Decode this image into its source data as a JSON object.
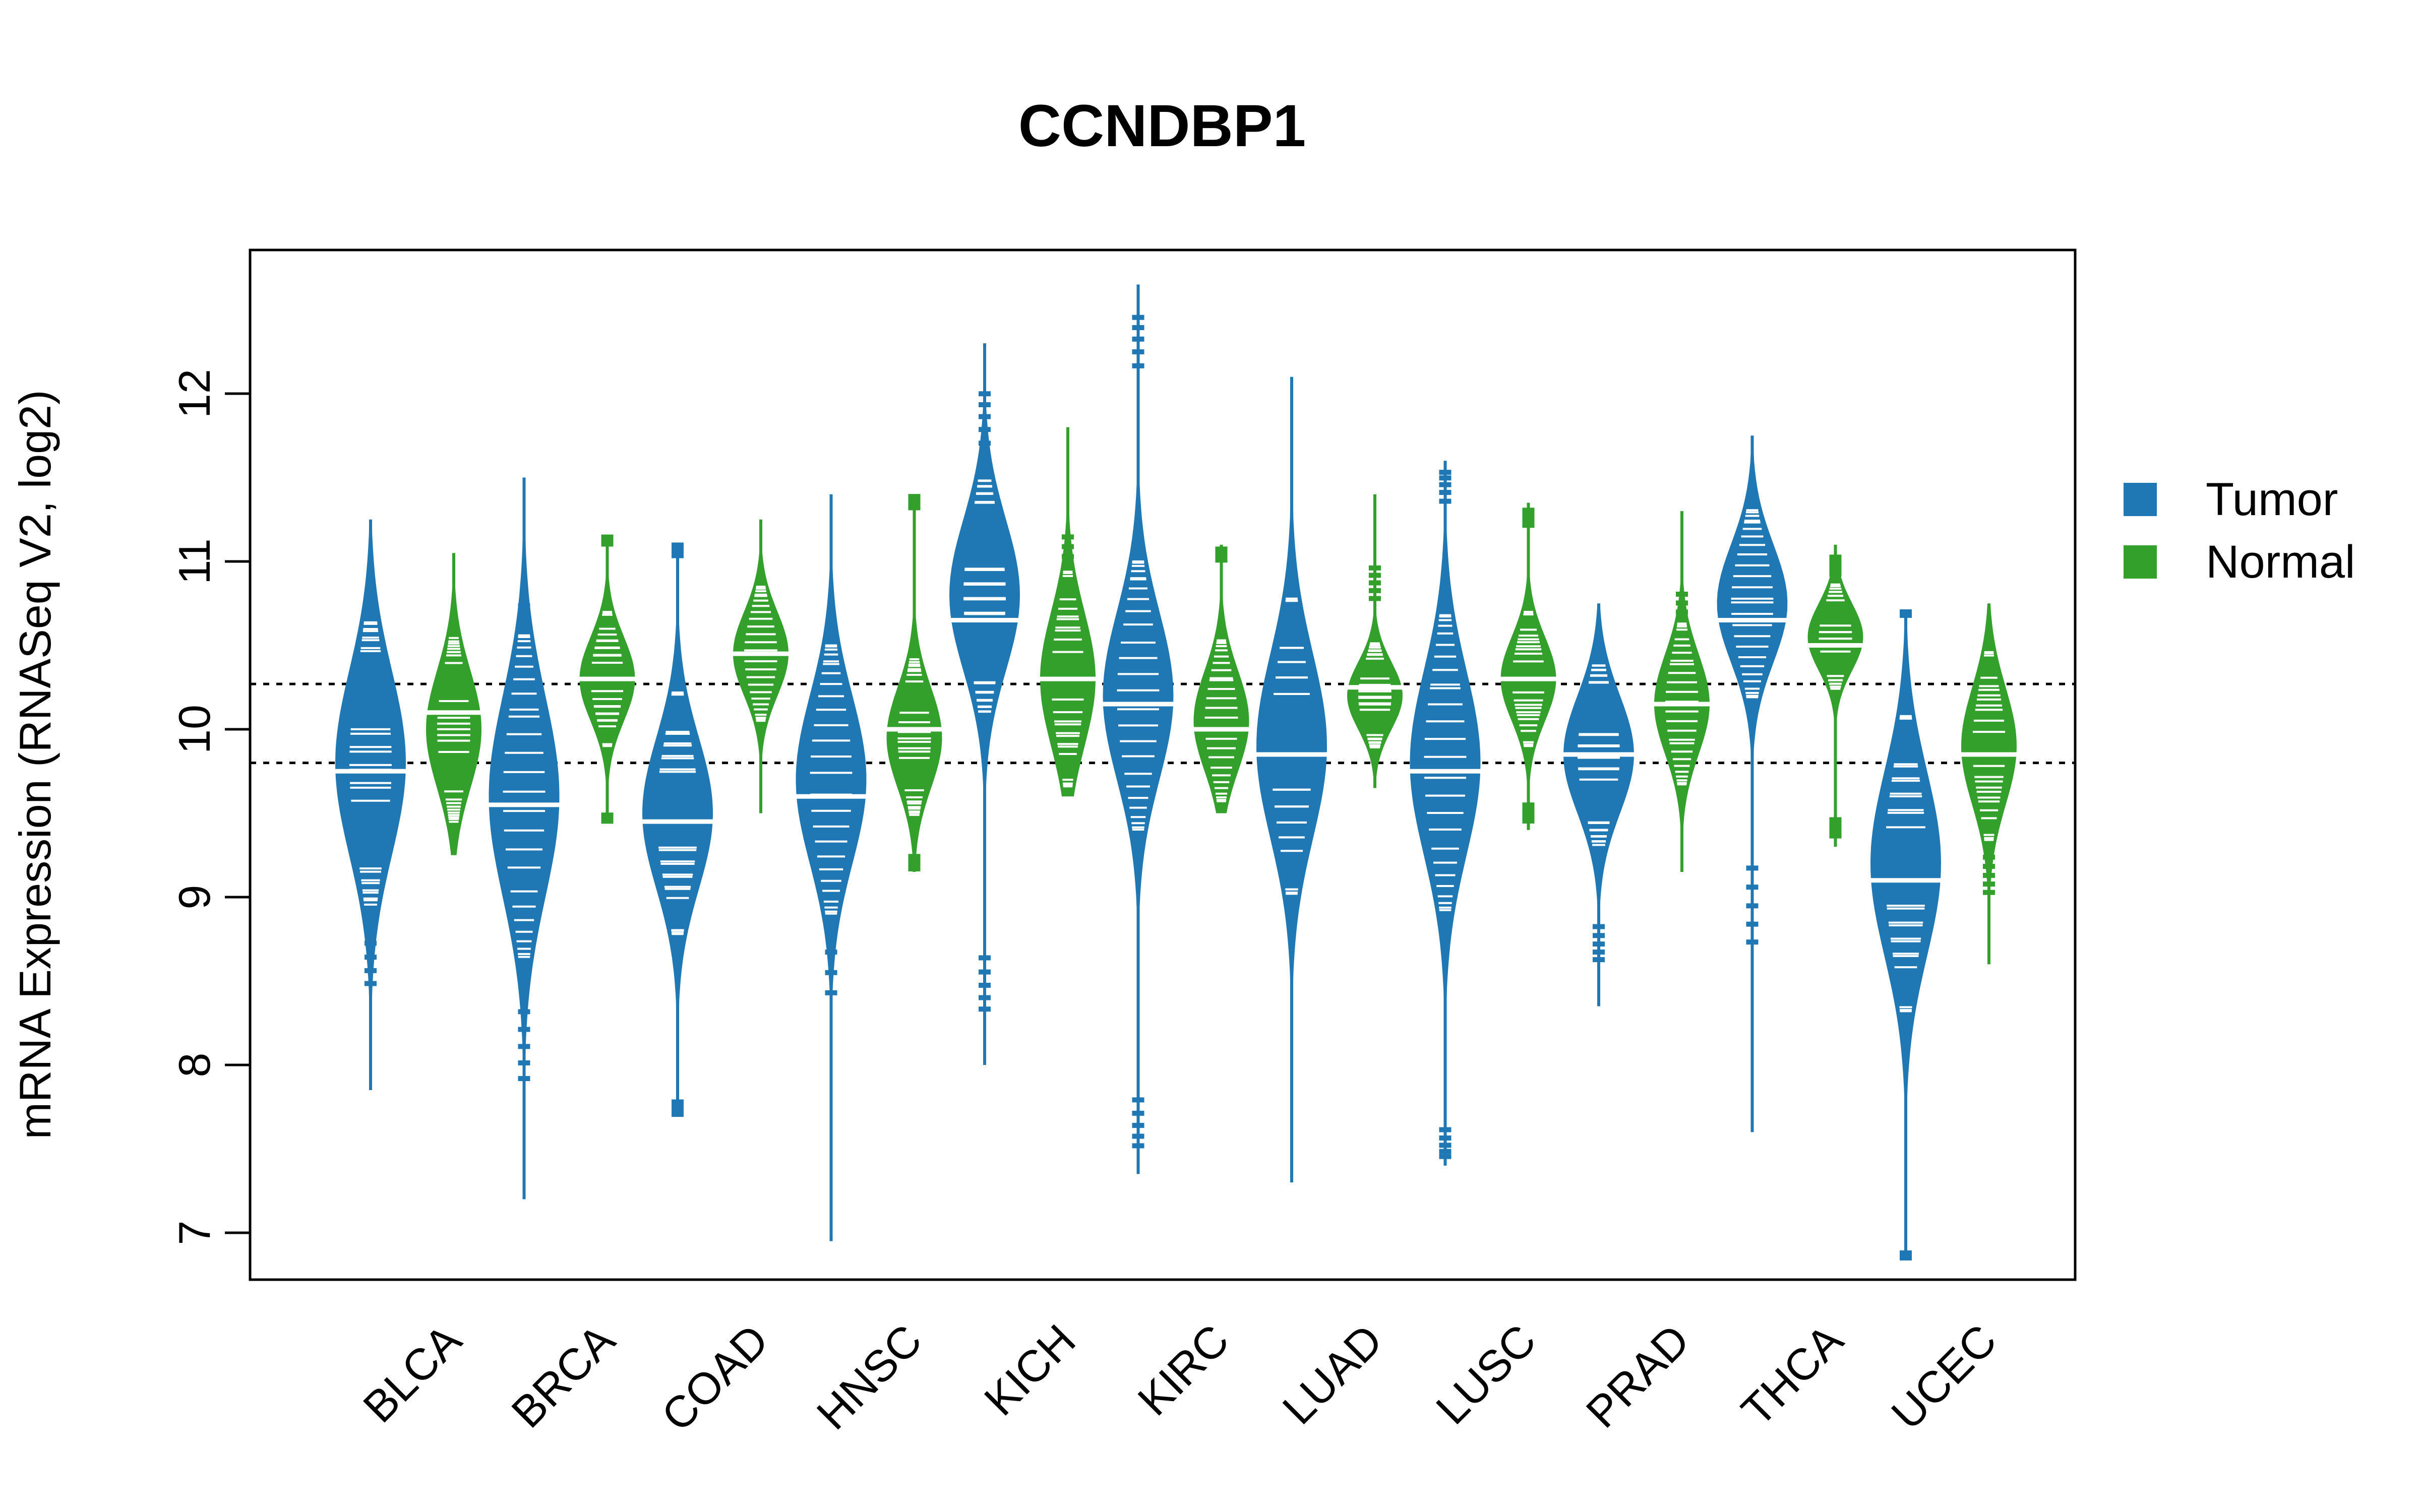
{
  "chart_data": {
    "type": "violin",
    "title": "CCNDBP1",
    "xlabel": "",
    "ylabel": "mRNA Expression (RNASeq V2, log2)",
    "ylim": [
      6.72,
      12.85
    ],
    "yticks": [
      7,
      8,
      9,
      10,
      11,
      12
    ],
    "categories": [
      "BLCA",
      "BRCA",
      "COAD",
      "HNSC",
      "KICH",
      "KIRC",
      "LUAD",
      "LUSC",
      "PRAD",
      "THCA",
      "UCEC"
    ],
    "reference_lines": [
      10.27,
      9.8
    ],
    "grid": false,
    "legend": {
      "position": "right",
      "entries": [
        {
          "label": "Tumor",
          "color": "#1f77b4"
        },
        {
          "label": "Normal",
          "color": "#33a02c"
        }
      ]
    },
    "series": [
      {
        "name": "Tumor",
        "color": "#1f77b4",
        "medians": [
          9.75,
          9.55,
          9.45,
          9.6,
          10.65,
          10.15,
          9.85,
          9.75,
          9.85,
          10.65,
          9.1
        ],
        "mins": [
          7.85,
          7.2,
          7.7,
          6.95,
          8.0,
          7.35,
          7.3,
          7.4,
          8.35,
          7.6,
          6.85
        ],
        "maxs": [
          11.25,
          11.5,
          11.1,
          11.4,
          12.3,
          12.65,
          12.1,
          11.6,
          10.75,
          11.75,
          10.7
        ],
        "density_peak": [
          9.8,
          9.6,
          9.5,
          9.7,
          10.8,
          10.2,
          9.9,
          9.8,
          9.85,
          10.75,
          9.2
        ],
        "spread": [
          0.55,
          0.6,
          0.45,
          0.5,
          0.45,
          0.5,
          0.55,
          0.55,
          0.35,
          0.35,
          0.55
        ]
      },
      {
        "name": "Normal",
        "color": "#33a02c",
        "medians": [
          10.1,
          10.3,
          10.45,
          10.0,
          10.3,
          10.0,
          10.25,
          10.3,
          10.15,
          10.5,
          9.85
        ],
        "mins": [
          9.25,
          9.45,
          9.5,
          9.15,
          9.6,
          9.5,
          9.65,
          9.4,
          9.15,
          9.3,
          8.6
        ],
        "maxs": [
          11.05,
          11.15,
          11.25,
          11.4,
          11.8,
          11.1,
          11.4,
          11.35,
          11.3,
          11.1,
          10.75
        ],
        "density_peak": [
          10.0,
          10.3,
          10.45,
          9.95,
          10.3,
          10.05,
          10.2,
          10.3,
          10.15,
          10.55,
          9.9
        ],
        "spread": [
          0.35,
          0.25,
          0.25,
          0.3,
          0.4,
          0.3,
          0.2,
          0.25,
          0.3,
          0.2,
          0.35
        ]
      }
    ]
  }
}
